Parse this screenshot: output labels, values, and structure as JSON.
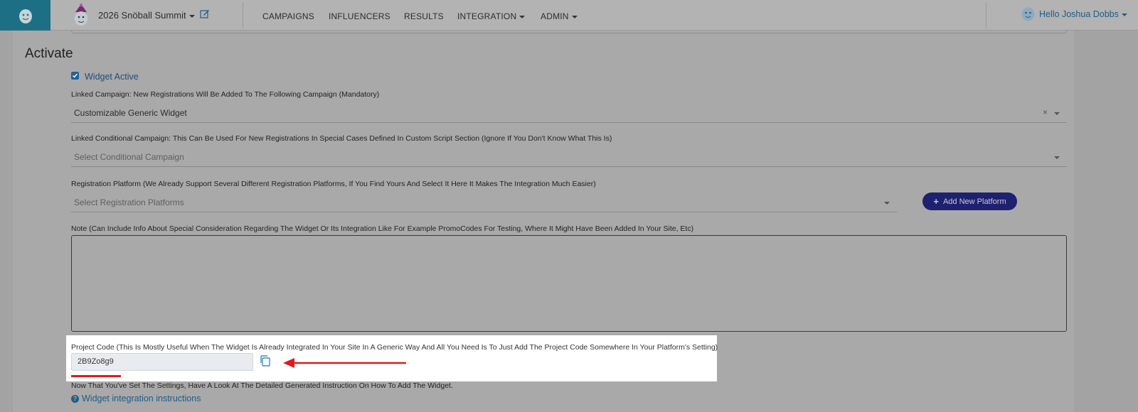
{
  "navbar": {
    "project_name": "2026 Snöball Summit",
    "items": [
      {
        "label": "CAMPAIGNS",
        "dropdown": false
      },
      {
        "label": "INFLUENCERS",
        "dropdown": false
      },
      {
        "label": "RESULTS",
        "dropdown": false
      },
      {
        "label": "INTEGRATION",
        "dropdown": true
      },
      {
        "label": "ADMIN",
        "dropdown": true
      }
    ],
    "user_greeting": "Hello Joshua Dobbs"
  },
  "section": {
    "title": "Activate"
  },
  "widget_active": {
    "label": "Widget Active",
    "checked": true
  },
  "linked_campaign": {
    "label": "Linked Campaign: New Registrations Will Be Added To The Following Campaign (Mandatory)",
    "value": "Customizable Generic Widget",
    "clear_symbol": "×"
  },
  "conditional_campaign": {
    "label": "Linked Conditional Campaign: This Can Be Used For New Registrations In Special Cases Defined In Custom Script Section (Ignore If You Don't Know What This Is)",
    "placeholder": "Select Conditional Campaign"
  },
  "registration_platform": {
    "label": "Registration Platform (We Already Support Several Different Registration Platforms, If You Find Yours And Select It Here It Makes The Integration Much Easier)",
    "placeholder": "Select Registration Platforms",
    "add_button": "Add New Platform"
  },
  "note": {
    "label": "Note (Can Include Info About Special Consideration Regarding The Widget Or Its Integration Like For Example PromoCodes For Testing, Where It Might Have Been Added In Your Site, Etc)",
    "value": ""
  },
  "project_code": {
    "label": "Project Code (This Is Mostly Useful When The Widget Is Already Integrated In Your Site In A Generic Way And All You Need Is To Just Add The Project Code Somewhere In Your Platform's Setting)",
    "value": "2B9Zo8g9"
  },
  "footer": {
    "text": "Now That You've Set The Settings, Have A Look At The Detailed Generated Instruction On How To Add The Widget.",
    "link": "Widget integration instructions"
  },
  "colors": {
    "accent_blue": "#1d5d86",
    "button_navy": "#1e2170",
    "annotation_red": "#e11a1a",
    "logo_teal": "#1d6f85"
  }
}
